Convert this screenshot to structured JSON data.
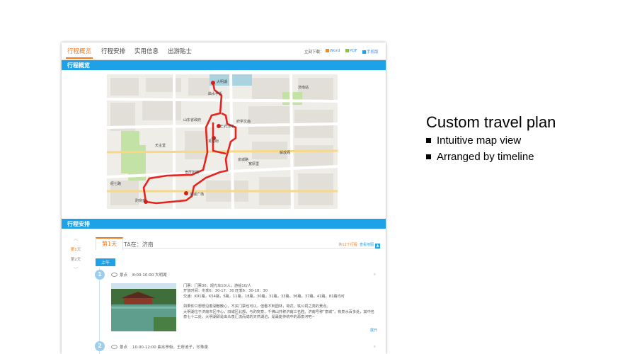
{
  "tabs": [
    "行程概览",
    "行程安排",
    "实用信息",
    "出游贴士"
  ],
  "download": {
    "label": "立刻下载：",
    "word": "Word",
    "pdf": "PDF",
    "mobile": "手机版"
  },
  "sections": {
    "overview": "行程概览",
    "arrangement": "行程安排"
  },
  "map": {
    "labels": [
      "趵突泉",
      "大明湖",
      "曲水亭街",
      "府学文庙",
      "芙蓉街",
      "泉城广场",
      "泉城路",
      "宽厚里",
      "王府池子",
      "天主堂",
      "解放阁",
      "山东省政府",
      "宽厚所街",
      "经七路",
      "济南站"
    ],
    "colors": {
      "route": "#e8221e",
      "marker": "#d3201b"
    }
  },
  "days": {
    "nav": [
      "第1天",
      "第2天"
    ],
    "current": "第1天",
    "ta": "TA在：济南",
    "count_prefix": "共",
    "count_value": "12个行程",
    "view_map": "查看地图",
    "period": "上午"
  },
  "items": [
    {
      "num": "1",
      "tag": "景点",
      "time": "8:00-10:00  大明湖",
      "lines": [
        "门票：门票30，观光车10/人，游船10/人",
        "开放时间：冬季6：30-17：30  旺季6：30-18：30",
        "交通：K91路，K54路，5路，11路，18路，30路，31路，33路，36路，37路，41路，81路均可",
        "",
        "如果你只想想沿着湖散散心，不买门票也可以，但看不到园林，荷花，铁公祠之类的景点。",
        "大明湖位于济南市区中心，旧城区北部，与趵突泉，千佛山并称济南三名胜。济南号称“泉城”，有泉水百多处，其中名泉七十二处。大明湖即是由众泉汇流而成的天然湖泊，是最能传统中的源泉河吧~"
      ],
      "more": "展开"
    },
    {
      "num": "2",
      "tag": "景点",
      "time": "10:00-12:00  曲水亭街，王府池子，珍珠泉"
    }
  ],
  "headline": "Custom travel plan",
  "features": [
    "Intuitive map view",
    "Arranged by timeline"
  ]
}
